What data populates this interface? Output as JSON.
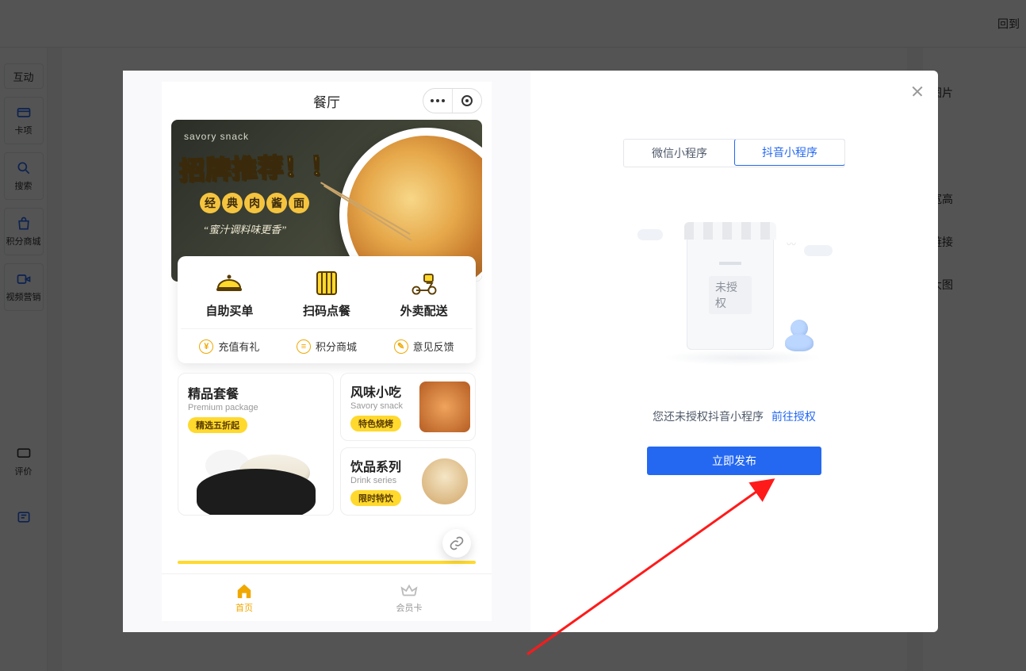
{
  "topbar": {
    "back": "回到"
  },
  "sidebar": {
    "interact": "互动",
    "items": [
      {
        "label": "卡项",
        "icon": "card-icon"
      },
      {
        "label": "搜索",
        "icon": "search-icon"
      },
      {
        "label": "积分商城",
        "icon": "points-mall-icon"
      },
      {
        "label": "视频营销",
        "icon": "video-icon"
      }
    ],
    "bottom": {
      "label": "评价",
      "icon": "comment-icon"
    }
  },
  "right_sidebar": {
    "rows": [
      "图片",
      "宽高",
      "链接",
      "大图"
    ]
  },
  "phone": {
    "title": "餐厅",
    "banner": {
      "brand": "savory snack",
      "head": "招牌推荐！！",
      "circle": [
        "经",
        "典",
        "肉",
        "酱",
        "面"
      ],
      "script": "“蜜汁调料味更香”"
    },
    "features": [
      {
        "label": "自助买单"
      },
      {
        "label": "扫码点餐"
      },
      {
        "label": "外卖配送"
      }
    ],
    "links": [
      {
        "icon": "¥",
        "label": "充值有礼"
      },
      {
        "icon": "≡",
        "label": "积分商城"
      },
      {
        "icon": "✎",
        "label": "意见反馈"
      }
    ],
    "cat_big": {
      "title": "精品套餐",
      "sub": "Premium package",
      "badge": "精选五折起"
    },
    "cat_small": [
      {
        "title": "风味小吃",
        "sub": "Savory snack",
        "badge": "特色烧烤"
      },
      {
        "title": "饮品系列",
        "sub": "Drink series",
        "badge": "限时特饮"
      }
    ],
    "nav": [
      {
        "label": "首页",
        "active": true
      },
      {
        "label": "会员卡",
        "active": false
      }
    ]
  },
  "panel": {
    "tabs": [
      {
        "label": "微信小程序",
        "active": false
      },
      {
        "label": "抖音小程序",
        "active": true
      }
    ],
    "empty_tag": "未授权",
    "hint_text": "您还未授权抖音小程序",
    "hint_link": "前往授权",
    "publish": "立即发布"
  }
}
